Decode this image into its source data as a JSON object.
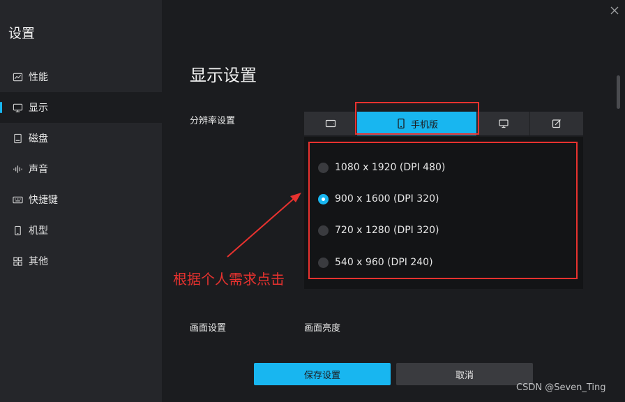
{
  "sidebar": {
    "title": "设置",
    "items": [
      {
        "label": "性能",
        "icon": "chart-line-icon"
      },
      {
        "label": "显示",
        "icon": "monitor-icon",
        "active": true
      },
      {
        "label": "磁盘",
        "icon": "disk-icon"
      },
      {
        "label": "声音",
        "icon": "audio-wave-icon"
      },
      {
        "label": "快捷键",
        "icon": "keyboard-icon"
      },
      {
        "label": "机型",
        "icon": "phone-icon"
      },
      {
        "label": "其他",
        "icon": "grid-icon"
      }
    ]
  },
  "main": {
    "title": "显示设置",
    "resolution_label": "分辨率设置",
    "tabs": [
      {
        "label": "",
        "icon": "tablet-landscape-icon"
      },
      {
        "label": "手机版",
        "icon": "phone-icon",
        "active": true
      },
      {
        "label": "",
        "icon": "desktop-icon"
      },
      {
        "label": "",
        "icon": "edit-icon"
      }
    ],
    "options": [
      {
        "label": "1080 x 1920 (DPI 480)",
        "checked": false
      },
      {
        "label": "900 x 1600 (DPI 320)",
        "checked": true
      },
      {
        "label": "720 x 1280 (DPI 320)",
        "checked": false
      },
      {
        "label": "540 x 960 (DPI 240)",
        "checked": false
      }
    ],
    "picture_label": "画面设置",
    "brightness_label": "画面亮度"
  },
  "buttons": {
    "save": "保存设置",
    "cancel": "取消"
  },
  "annotation": {
    "text": "根据个人需求点击"
  },
  "watermark": "CSDN @Seven_Ting",
  "colors": {
    "accent": "#18b6f0",
    "annotation": "#e8322f",
    "sidebar_bg": "#25262a",
    "main_bg": "#1b1c1f"
  }
}
